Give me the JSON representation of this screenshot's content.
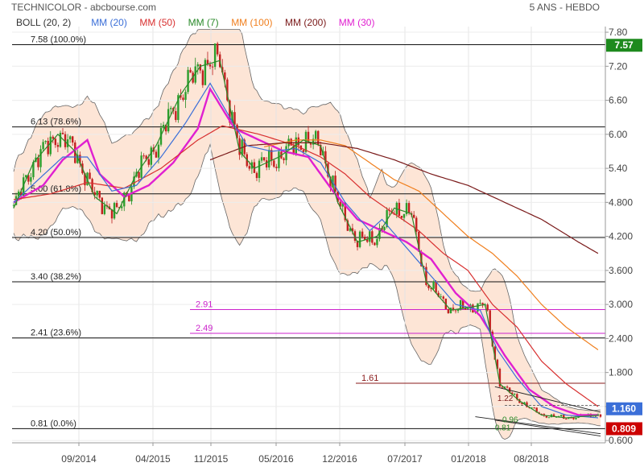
{
  "header": {
    "title": "TECHNICOLOR - abcbourse.com",
    "period": "5 ANS - HEBDO"
  },
  "legend": [
    {
      "label": "BOLL (20, 2)",
      "color": "#333333"
    },
    {
      "label": "MM (20)",
      "color": "#3b6fd8"
    },
    {
      "label": "MM (50)",
      "color": "#d83030"
    },
    {
      "label": "MM (7)",
      "color": "#2a8a2a"
    },
    {
      "label": "MM (100)",
      "color": "#f07f1e"
    },
    {
      "label": "MM (200)",
      "color": "#7a1a1a"
    },
    {
      "label": "MM (30)",
      "color": "#e020d0"
    }
  ],
  "chart_data": {
    "type": "line",
    "ylim": [
      0.56,
      7.9
    ],
    "y_ticks": [
      "7.80",
      "7.20",
      "6.60",
      "6.00",
      "5.40",
      "4.800",
      "4.200",
      "3.600",
      "3.000",
      "2.400",
      "1.800",
      "1.200",
      "0.600"
    ],
    "y_tick_values": [
      7.8,
      7.2,
      6.6,
      6.0,
      5.4,
      4.8,
      4.2,
      3.6,
      3.0,
      2.4,
      1.8,
      1.2,
      0.6
    ],
    "x_tick_labels": [
      "09/2014",
      "04/2015",
      "11/2015",
      "05/2016",
      "12/2016",
      "07/2017",
      "01/2018",
      "08/2018"
    ],
    "fibonacci": [
      {
        "label": "7.58  (100.0%)",
        "value": 7.58
      },
      {
        "label": "6.13  (78.6%)",
        "value": 6.13
      },
      {
        "label": "5.00  (61.8%)",
        "value": 4.95
      },
      {
        "label": "4.20  (50.0%)",
        "value": 4.18
      },
      {
        "label": "3.40  (38.2%)",
        "value": 3.4
      },
      {
        "label": "2.41  (23.6%)",
        "value": 2.41
      },
      {
        "label": "0.81  (0.0%)",
        "value": 0.81
      }
    ],
    "horizontal_levels": [
      {
        "label": "2.91",
        "value": 2.91,
        "color": "#cc22cc"
      },
      {
        "label": "2.49",
        "value": 2.49,
        "color": "#cc22cc"
      },
      {
        "label": "1.61",
        "value": 1.61,
        "color": "#8a1a1a"
      }
    ],
    "small_labels": [
      "1.22",
      "0.96",
      "0.81"
    ],
    "current_price": {
      "label": "1.160",
      "value": 1.16,
      "color": "#3b6fd8"
    },
    "fib_top_badge": {
      "label": "7.57",
      "value": 7.57,
      "color": "#1e8a1e"
    },
    "low_badge": {
      "label": "0.809",
      "value": 0.809,
      "color": "#cc0000"
    },
    "series": [
      {
        "name": "MM (30)",
        "color": "#e020d0",
        "points": [
          [
            0,
            4.8
          ],
          [
            12,
            5.1
          ],
          [
            20,
            5.55
          ],
          [
            30,
            5.9
          ],
          [
            35,
            5.3
          ],
          [
            45,
            4.9
          ],
          [
            55,
            5.1
          ],
          [
            65,
            5.5
          ],
          [
            75,
            6.1
          ],
          [
            80,
            6.8
          ],
          [
            90,
            6.1
          ],
          [
            100,
            5.9
          ],
          [
            110,
            5.7
          ],
          [
            120,
            5.6
          ],
          [
            130,
            5.0
          ],
          [
            140,
            4.5
          ],
          [
            150,
            4.3
          ],
          [
            160,
            4.1
          ],
          [
            170,
            3.8
          ],
          [
            180,
            3.2
          ],
          [
            190,
            2.8
          ],
          [
            200,
            2.1
          ],
          [
            210,
            1.5
          ],
          [
            220,
            1.2
          ],
          [
            230,
            1.05
          ],
          [
            238,
            1.05
          ]
        ]
      },
      {
        "name": "MM (50)",
        "color": "#d83030",
        "points": [
          [
            0,
            4.85
          ],
          [
            15,
            4.95
          ],
          [
            30,
            5.15
          ],
          [
            45,
            5.05
          ],
          [
            60,
            5.4
          ],
          [
            75,
            5.9
          ],
          [
            85,
            6.15
          ],
          [
            100,
            6.0
          ],
          [
            115,
            5.8
          ],
          [
            125,
            5.6
          ],
          [
            135,
            5.3
          ],
          [
            145,
            4.9
          ],
          [
            155,
            4.6
          ],
          [
            165,
            4.3
          ],
          [
            175,
            3.9
          ],
          [
            185,
            3.6
          ],
          [
            195,
            3.0
          ],
          [
            205,
            2.6
          ],
          [
            215,
            2.0
          ],
          [
            225,
            1.6
          ],
          [
            238,
            1.2
          ]
        ]
      },
      {
        "name": "MM (100)",
        "color": "#f07f1e",
        "points": [
          [
            102,
            5.78
          ],
          [
            115,
            5.9
          ],
          [
            125,
            5.9
          ],
          [
            135,
            5.8
          ],
          [
            145,
            5.5
          ],
          [
            155,
            5.2
          ],
          [
            165,
            5.0
          ],
          [
            175,
            4.6
          ],
          [
            185,
            4.2
          ],
          [
            195,
            3.9
          ],
          [
            205,
            3.5
          ],
          [
            215,
            3.0
          ],
          [
            225,
            2.6
          ],
          [
            238,
            2.2
          ]
        ]
      },
      {
        "name": "MM (200)",
        "color": "#7a1a1a",
        "points": [
          [
            80,
            5.55
          ],
          [
            95,
            5.8
          ],
          [
            110,
            5.85
          ],
          [
            125,
            5.85
          ],
          [
            140,
            5.75
          ],
          [
            155,
            5.55
          ],
          [
            170,
            5.3
          ],
          [
            185,
            5.1
          ],
          [
            200,
            4.8
          ],
          [
            215,
            4.5
          ],
          [
            230,
            4.1
          ],
          [
            238,
            3.9
          ]
        ]
      },
      {
        "name": "MM (20)",
        "color": "#3b6fd8",
        "points": [
          [
            0,
            4.8
          ],
          [
            10,
            5.2
          ],
          [
            20,
            5.6
          ],
          [
            30,
            5.6
          ],
          [
            40,
            5.0
          ],
          [
            50,
            5.1
          ],
          [
            60,
            5.6
          ],
          [
            70,
            6.2
          ],
          [
            80,
            6.9
          ],
          [
            88,
            6.3
          ],
          [
            95,
            5.8
          ],
          [
            105,
            5.7
          ],
          [
            115,
            5.75
          ],
          [
            125,
            5.5
          ],
          [
            135,
            4.8
          ],
          [
            145,
            4.3
          ],
          [
            150,
            4.5
          ],
          [
            160,
            4.0
          ],
          [
            170,
            3.5
          ],
          [
            180,
            3.0
          ],
          [
            190,
            2.9
          ],
          [
            197,
            2.2
          ],
          [
            205,
            1.7
          ],
          [
            215,
            1.2
          ],
          [
            225,
            1.05
          ],
          [
            238,
            1.0
          ]
        ]
      },
      {
        "name": "MM (7)",
        "color": "#2a8a2a",
        "points": [
          [
            0,
            4.7
          ],
          [
            8,
            5.5
          ],
          [
            18,
            6.0
          ],
          [
            25,
            5.7
          ],
          [
            33,
            4.9
          ],
          [
            42,
            4.6
          ],
          [
            50,
            5.3
          ],
          [
            58,
            5.8
          ],
          [
            68,
            6.7
          ],
          [
            76,
            7.2
          ],
          [
            84,
            7.3
          ],
          [
            92,
            5.7
          ],
          [
            98,
            5.4
          ],
          [
            108,
            5.6
          ],
          [
            118,
            5.9
          ],
          [
            125,
            5.8
          ],
          [
            132,
            4.8
          ],
          [
            140,
            4.1
          ],
          [
            148,
            4.2
          ],
          [
            155,
            4.7
          ],
          [
            162,
            4.6
          ],
          [
            168,
            3.4
          ],
          [
            178,
            2.9
          ],
          [
            186,
            2.95
          ],
          [
            192,
            3.0
          ],
          [
            198,
            1.6
          ],
          [
            206,
            1.3
          ],
          [
            215,
            1.05
          ],
          [
            225,
            1.0
          ],
          [
            238,
            1.05
          ]
        ]
      }
    ]
  }
}
